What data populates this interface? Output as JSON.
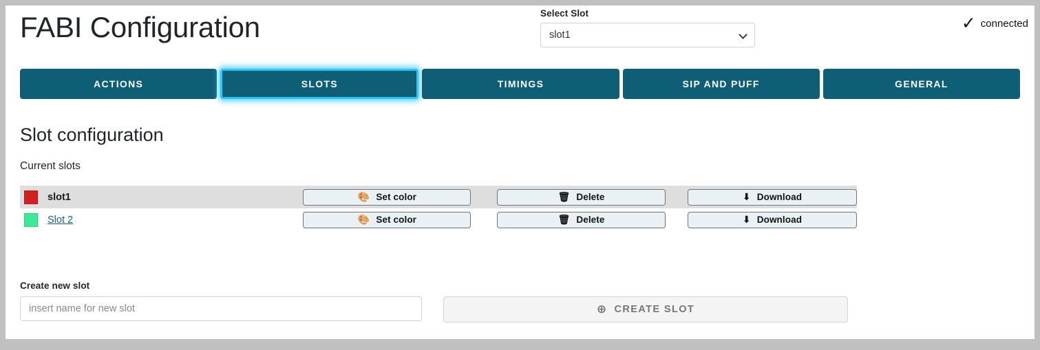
{
  "header": {
    "title": "FABI Configuration",
    "select_slot_label": "Select Slot",
    "selected_slot": "slot1",
    "slot_options": [
      "slot1",
      "Slot 2"
    ],
    "connection_status": "connected",
    "connection_icon": "checkmark-icon",
    "connection_glyph": "✓",
    "chevron_icon": "chevron-down-icon"
  },
  "tabs": [
    {
      "label": "ACTIONS",
      "active": false
    },
    {
      "label": "SLOTS",
      "active": true
    },
    {
      "label": "TIMINGS",
      "active": false
    },
    {
      "label": "SIP AND PUFF",
      "active": false
    },
    {
      "label": "GENERAL",
      "active": false
    }
  ],
  "main": {
    "section_title": "Slot configuration",
    "current_slots_label": "Current slots",
    "buttons": {
      "set_color": "Set color",
      "delete": "Delete",
      "download": "Download",
      "set_color_icon": "palette-icon",
      "set_color_glyph": "🎨",
      "delete_icon": "trash-icon",
      "delete_glyph": "🗑",
      "download_icon": "download-icon",
      "download_glyph": "⬇"
    },
    "slots": [
      {
        "name": "slot1",
        "color": "#d41f1f",
        "selected": true
      },
      {
        "name": "Slot 2",
        "color": "#3aeb96",
        "selected": false
      }
    ]
  },
  "create": {
    "label": "Create new slot",
    "input_value": "",
    "input_placeholder": "insert name for new slot",
    "button_label": "CREATE SLOT",
    "button_icon": "plus-circle-icon",
    "button_glyph": "⊕",
    "button_disabled": true
  },
  "colors": {
    "tab_teal": "#0e5e76",
    "tab_active_border": "#29c5f6",
    "row_selected_bg": "#dedede",
    "button_bg": "#e9f1f4",
    "link": "#1c5d7a"
  }
}
